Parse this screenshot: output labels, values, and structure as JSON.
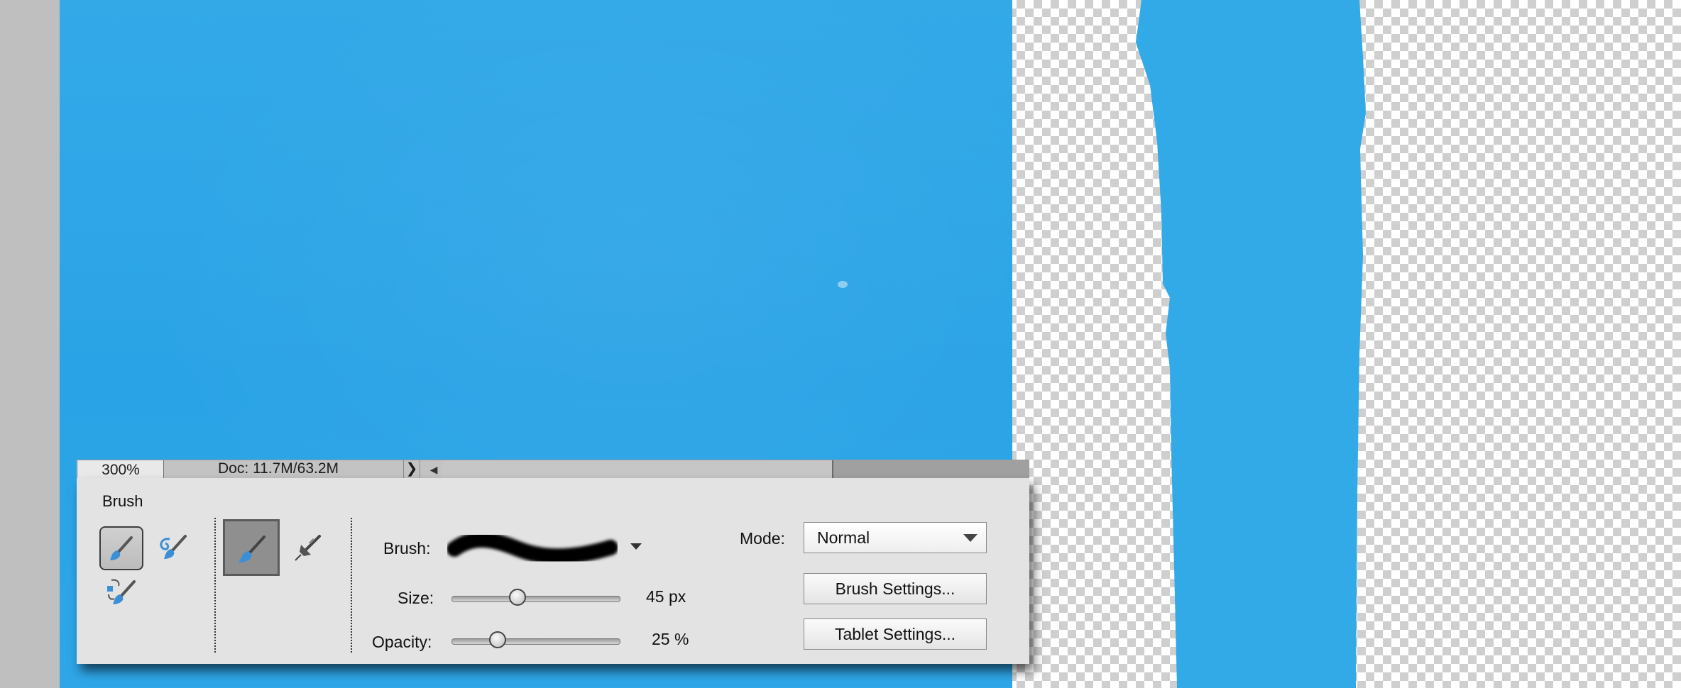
{
  "status_bar": {
    "zoom": "300%",
    "doc_info": "Doc: 11.7M/63.2M",
    "arrow_glyph": "❯",
    "scroll_left_glyph": "◀"
  },
  "tool_options": {
    "tool_name": "Brush",
    "brush_label": "Brush:",
    "size_label": "Size:",
    "size_value": "45 px",
    "opacity_label": "Opacity:",
    "opacity_value": "25 %",
    "mode_label": "Mode:",
    "mode_value": "Normal",
    "brush_settings_label": "Brush Settings...",
    "tablet_settings_label": "Tablet Settings..."
  },
  "tools": [
    {
      "icon": "brush-icon",
      "selected": true
    },
    {
      "icon": "impressionist-brush-icon",
      "selected": false
    },
    {
      "icon": "color-replacement-icon",
      "selected": false
    }
  ],
  "brush_modes": [
    {
      "icon": "brush-mode-icon",
      "selected": true
    },
    {
      "icon": "airbrush-icon",
      "selected": false
    }
  ],
  "slider_levels": {
    "size_fraction": 0.37,
    "opacity_fraction": 0.25
  },
  "colors": {
    "canvas_blue": "#2ea6e7",
    "panel_bg": "#e3e3e3"
  }
}
